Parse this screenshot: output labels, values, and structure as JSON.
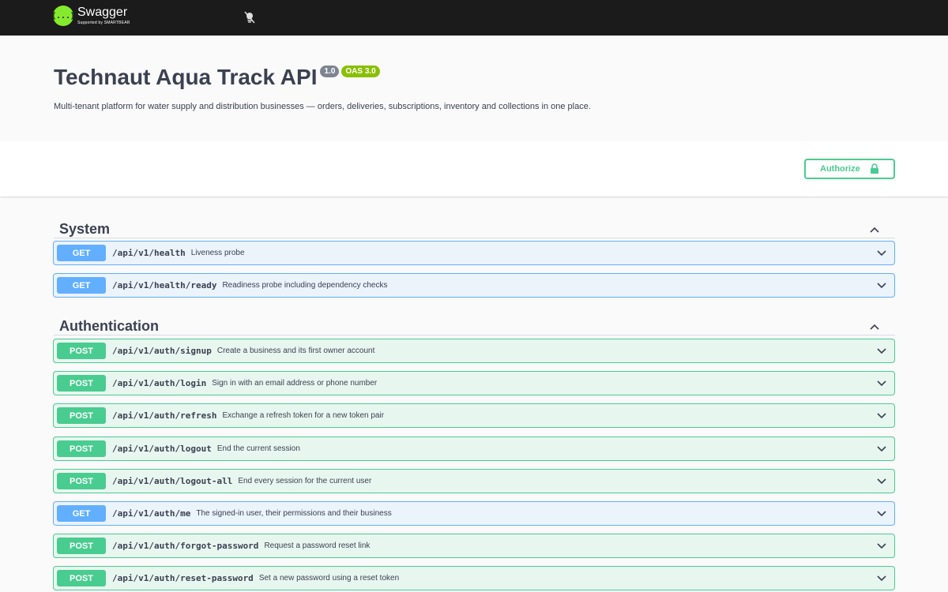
{
  "topbar": {
    "logo_mark": "{...}",
    "logo_name": "Swagger",
    "logo_sub": "Supported by SMARTBEAR",
    "icons": [
      "swagger-logo-icon",
      "dark-mode-toggle-icon"
    ]
  },
  "info": {
    "title": "Technaut Aqua Track API",
    "version": "1.0",
    "oas": "OAS 3.0",
    "description": "Multi-tenant platform for water supply and distribution businesses — orders, deliveries, subscriptions, inventory and collections in one place."
  },
  "authorize": {
    "label": "Authorize",
    "icon": "lock-icon"
  },
  "colors": {
    "get": "#61affe",
    "post": "#49cc90",
    "topbar": "#1b1b1b"
  },
  "sections": [
    {
      "title": "System",
      "operations": [
        {
          "method": "GET",
          "path": "/api/v1/health",
          "summary": "Liveness probe"
        },
        {
          "method": "GET",
          "path": "/api/v1/health/ready",
          "summary": "Readiness probe including dependency checks"
        }
      ]
    },
    {
      "title": "Authentication",
      "operations": [
        {
          "method": "POST",
          "path": "/api/v1/auth/signup",
          "summary": "Create a business and its first owner account"
        },
        {
          "method": "POST",
          "path": "/api/v1/auth/login",
          "summary": "Sign in with an email address or phone number"
        },
        {
          "method": "POST",
          "path": "/api/v1/auth/refresh",
          "summary": "Exchange a refresh token for a new token pair"
        },
        {
          "method": "POST",
          "path": "/api/v1/auth/logout",
          "summary": "End the current session"
        },
        {
          "method": "POST",
          "path": "/api/v1/auth/logout-all",
          "summary": "End every session for the current user"
        },
        {
          "method": "GET",
          "path": "/api/v1/auth/me",
          "summary": "The signed-in user, their permissions and their business"
        },
        {
          "method": "POST",
          "path": "/api/v1/auth/forgot-password",
          "summary": "Request a password reset link"
        },
        {
          "method": "POST",
          "path": "/api/v1/auth/reset-password",
          "summary": "Set a new password using a reset token"
        }
      ]
    }
  ]
}
